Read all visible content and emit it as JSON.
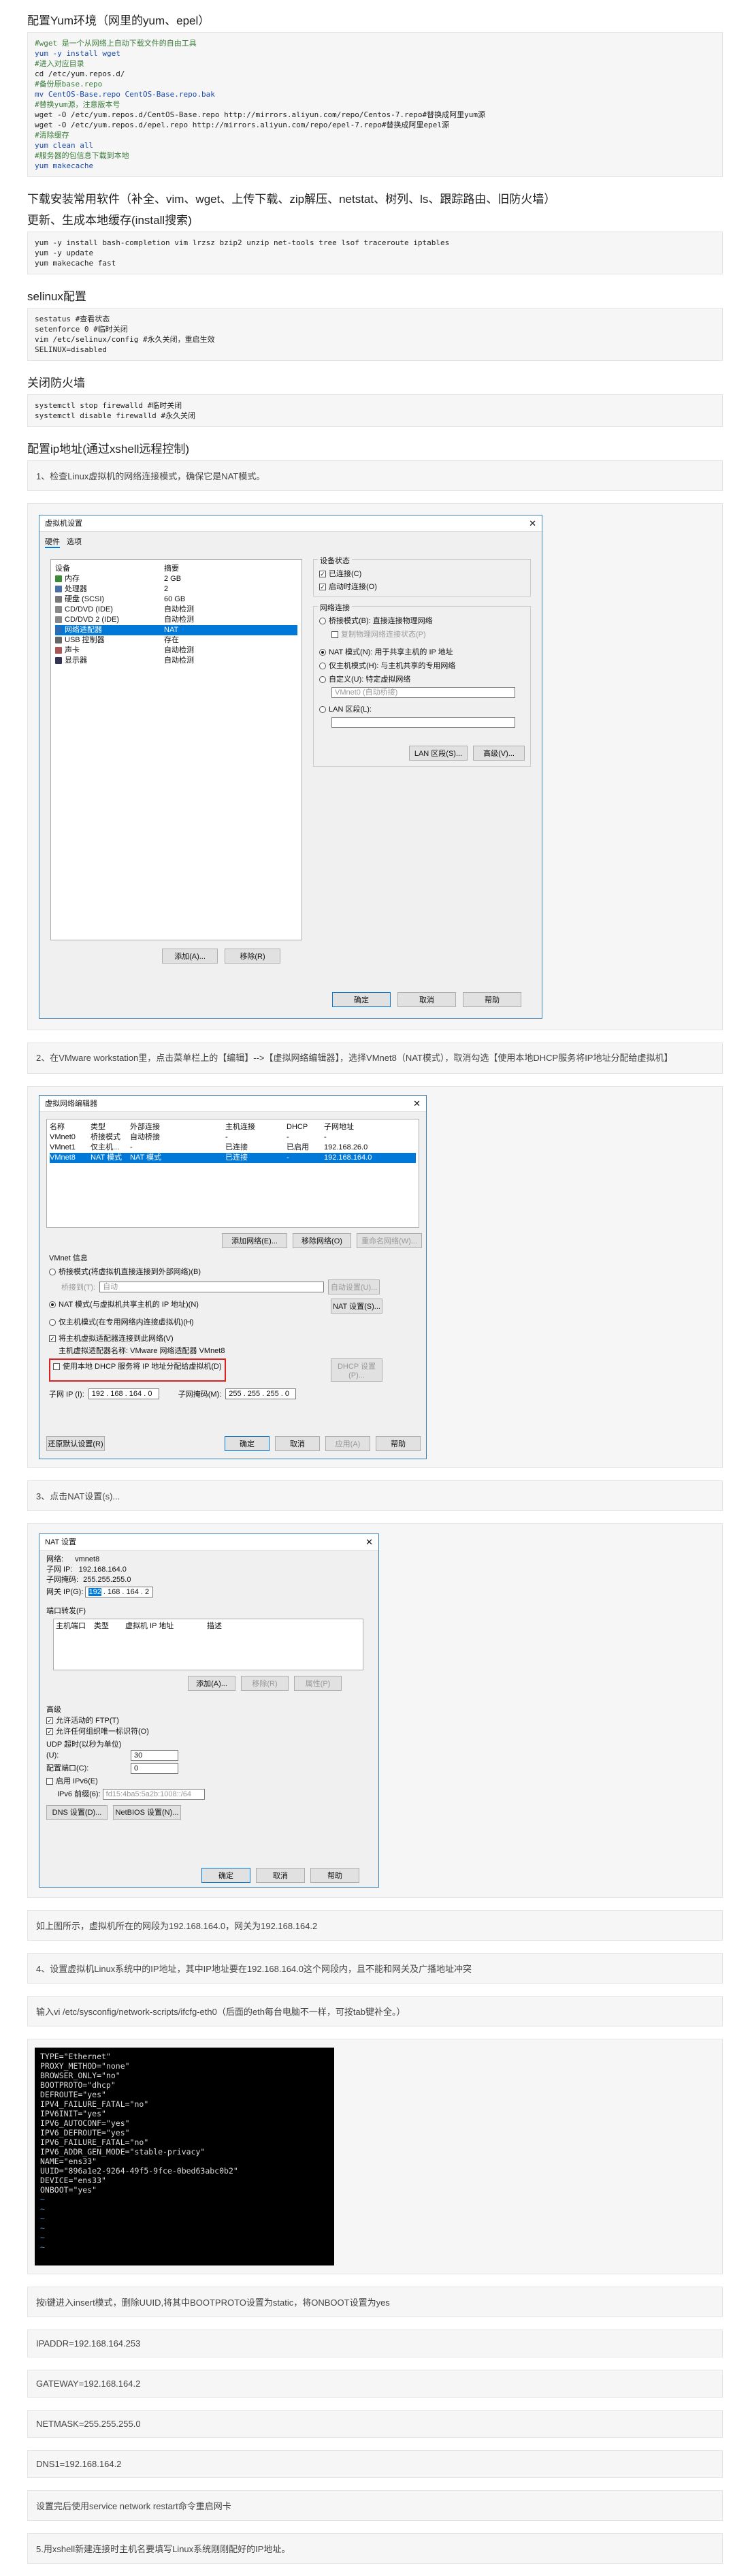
{
  "yum": {
    "title": "配置Yum环境（网里的yum、epel）",
    "lines": [
      {
        "t": "#wget 是一个从网络上自动下载文件的自由工具",
        "c": "c"
      },
      {
        "t": "yum -y install wget",
        "c": "k"
      },
      {
        "t": "#进入对应目录",
        "c": "c"
      },
      {
        "t": "cd /etc/yum.repos.d/",
        "c": ""
      },
      {
        "t": "#备份原base.repo",
        "c": "c"
      },
      {
        "t": "mv CentOS-Base.repo CentOS-Base.repo.bak",
        "c": "k"
      },
      {
        "t": "#替换yum源，注意版本号",
        "c": "c"
      },
      {
        "t": "wget -O /etc/yum.repos.d/CentOS-Base.repo http://mirrors.aliyun.com/repo/Centos-7.repo#替换成阿里yum源",
        "c": ""
      },
      {
        "t": "wget -O /etc/yum.repos.d/epel.repo http://mirrors.aliyun.com/repo/epel-7.repo#替换成阿里epel源",
        "c": ""
      },
      {
        "t": "#清除缓存",
        "c": "c"
      },
      {
        "t": "yum clean all",
        "c": "k"
      },
      {
        "t": "#服务器的包信息下载到本地",
        "c": "c"
      },
      {
        "t": "yum makecache",
        "c": "k"
      }
    ]
  },
  "soft": {
    "title": "下载安装常用软件（补全、vim、wget、上传下载、zip解压、netstat、树列、ls、跟踪路由、旧防火墙）",
    "title2": "更新、生成本地缓存(install搜索)",
    "lines": [
      "yum -y install bash-completion vim lrzsz bzip2 unzip net-tools tree lsof traceroute iptables",
      "yum -y update",
      "yum makecache fast"
    ]
  },
  "selinux": {
    "title": "selinux配置",
    "lines": [
      "sestatus #查看状态",
      "setenforce 0 #临时关闭",
      "vim /etc/selinux/config #永久关闭，重启生效",
      "SELINUX=disabled"
    ]
  },
  "firewall": {
    "title": "关闭防火墙",
    "lines": [
      "systemctl stop firewalld #临时关闭",
      "systemctl disable firewalld #永久关闭"
    ]
  },
  "ip": {
    "title": "配置ip地址(通过xshell远程控制)",
    "step1": "1、检查Linux虚拟机的网络连接模式，确保它是NAT模式。",
    "step2": "2、在VMware workstation里，点击菜单栏上的【编辑】-->【虚拟网络编辑器】，选择VMnet8（NAT模式），取消勾选【使用本地DHCP服务将IP地址分配给虚拟机】",
    "step3": "3、点击NAT设置(s)...",
    "note_gw": "如上图所示，虚拟机所在的网段为192.168.164.0，网关为192.168.164.2",
    "step4": "4、设置虚拟机Linux系统中的IP地址，其中IP地址要在192.168.164.0这个网段内，且不能和网关及广播地址冲突",
    "step5": "输入vi /etc/sysconfig/network-scripts/ifcfg-eth0（后面的eth每台电脑不一样，可按tab键补全。）",
    "edit_note": "按i键进入insert模式，删除UUID,将其中BOOTPROTO设置为static，将ONBOOT设置为yes",
    "ipaddr": "IPADDR=192.168.164.253",
    "gateway": "GATEWAY=192.168.164.2",
    "netmask": "NETMASK=255.255.255.0",
    "dns": "DNS1=192.168.164.2",
    "restart": "设置完后使用service network restart命令重启网卡",
    "xshell": "5.用xshell新建连接时主机名要填写Linux系统刚刚配好的IP地址。"
  },
  "vm_dialog": {
    "title": "虚拟机设置",
    "tabs": [
      "硬件",
      "选项"
    ],
    "col_device": "设备",
    "col_summary": "摘要",
    "devices": [
      {
        "name": "内存",
        "summary": "2 GB",
        "color": "#3a8a3a"
      },
      {
        "name": "处理器",
        "summary": "2",
        "color": "#4a6fa5"
      },
      {
        "name": "硬盘 (SCSI)",
        "summary": "60 GB",
        "color": "#777"
      },
      {
        "name": "CD/DVD (IDE)",
        "summary": "自动检测",
        "color": "#888"
      },
      {
        "name": "CD/DVD 2 (IDE)",
        "summary": "自动检测",
        "color": "#888"
      },
      {
        "name": "网络适配器",
        "summary": "NAT",
        "color": "#2f6bb3"
      },
      {
        "name": "USB 控制器",
        "summary": "存在",
        "color": "#666"
      },
      {
        "name": "声卡",
        "summary": "自动检测",
        "color": "#a55"
      },
      {
        "name": "显示器",
        "summary": "自动检测",
        "color": "#335"
      }
    ],
    "status_title": "设备状态",
    "connected": "已连接(C)",
    "connect_on_start": "启动时连接(O)",
    "net_title": "网络连接",
    "opt_bridged": "桥接模式(B): 直接连接物理网络",
    "opt_replicate": "复制物理网络连接状态(P)",
    "opt_nat": "NAT 模式(N): 用于共享主机的 IP 地址",
    "opt_host": "仅主机模式(H): 与主机共享的专用网络",
    "opt_custom": "自定义(U): 特定虚拟网络",
    "custom_val": "VMnet0 (自动桥接)",
    "opt_lan": "LAN 区段(L):",
    "lan_btn": "LAN 区段(S)...",
    "adv_btn": "高级(V)...",
    "add_btn": "添加(A)...",
    "remove_btn": "移除(R)",
    "ok": "确定",
    "cancel": "取消",
    "help": "帮助"
  },
  "vne_dialog": {
    "title": "虚拟网络编辑器",
    "cols": [
      "名称",
      "类型",
      "外部连接",
      "主机连接",
      "DHCP",
      "子网地址"
    ],
    "rows": [
      [
        "VMnet0",
        "桥接模式",
        "自动桥接",
        "-",
        "-",
        "-"
      ],
      [
        "VMnet1",
        "仅主机...",
        "-",
        "已连接",
        "已启用",
        "192.168.26.0"
      ],
      [
        "VMnet8",
        "NAT 模式",
        "NAT 模式",
        "已连接",
        "-",
        "192.168.164.0"
      ]
    ],
    "add_net": "添加网络(E)...",
    "remove_net": "移除网络(O)",
    "rename_net": "重命名网络(W)...",
    "info_title": "VMnet 信息",
    "opt_bridged": "桥接模式(将虚拟机直接连接到外部网络)(B)",
    "bridged_to": "桥接到(T):",
    "bridged_val": "自动",
    "auto_settings": "自动设置(U)...",
    "opt_nat": "NAT 模式(与虚拟机共享主机的 IP 地址)(N)",
    "nat_settings": "NAT 设置(S)...",
    "opt_host": "仅主机模式(在专用网络内连接虚拟机)(H)",
    "chk_adapter": "将主机虚拟适配器连接到此网络(V)",
    "adapter_name": "主机虚拟适配器名称: VMware 网络适配器 VMnet8",
    "chk_dhcp": "使用本地 DHCP 服务将 IP 地址分配给虚拟机(D)",
    "dhcp_settings": "DHCP 设置(P)...",
    "subnet_ip_label": "子网 IP (I):",
    "subnet_ip": "192 . 168 . 164 . 0",
    "mask_label": "子网掩码(M):",
    "mask": "255 . 255 . 255 . 0",
    "restore": "还原默认设置(R)",
    "ok": "确定",
    "cancel": "取消",
    "apply": "应用(A)",
    "help": "帮助"
  },
  "nat_dialog": {
    "title": "NAT 设置",
    "network_label": "网络:",
    "network": "vmnet8",
    "subnet_ip_label": "子网 IP:",
    "subnet_ip": "192.168.164.0",
    "mask_label": "子网掩码:",
    "mask": "255.255.255.0",
    "gw_label": "网关 IP(G):",
    "gw_sel": "192",
    "gw_rest": ". 168 . 164 . 2",
    "port_title": "端口转发(F)",
    "port_cols": [
      "主机端口",
      "类型",
      "虚拟机 IP 地址",
      "描述"
    ],
    "add": "添加(A)...",
    "remove": "移除(R)",
    "props": "属性(P)",
    "adv_title": "高级",
    "chk_ftp": "允许活动的 FTP(T)",
    "chk_oui": "允许任何组织唯一标识符(O)",
    "udp_label": "UDP 超时(以秒为单位)(U):",
    "udp": "30",
    "cfg_port_label": "配置端口(C):",
    "cfg_port": "0",
    "chk_ipv6": "启用 IPv6(E)",
    "ipv6_label": "IPv6 前缀(6):",
    "ipv6": "fd15:4ba5:5a2b:1008::/64",
    "dns_btn": "DNS 设置(D)...",
    "netbios_btn": "NetBIOS 设置(N)...",
    "ok": "确定",
    "cancel": "取消",
    "help": "帮助"
  },
  "terminal": {
    "lines": [
      "TYPE=\"Ethernet\"",
      "PROXY_METHOD=\"none\"",
      "BROWSER_ONLY=\"no\"",
      "BOOTPROTO=\"dhcp\"",
      "DEFROUTE=\"yes\"",
      "IPV4_FAILURE_FATAL=\"no\"",
      "IPV6INIT=\"yes\"",
      "IPV6_AUTOCONF=\"yes\"",
      "IPV6_DEFROUTE=\"yes\"",
      "IPV6_FAILURE_FATAL=\"no\"",
      "IPV6_ADDR_GEN_MODE=\"stable-privacy\"",
      "NAME=\"ens33\"",
      "UUID=\"896a1e2-9264-49f5-9fce-0bed63abc0b2\"",
      "DEVICE=\"ens33\"",
      "ONBOOT=\"yes\""
    ],
    "tilde": "~"
  },
  "colors": {
    "accent": "#0078d7",
    "highlight_box": "#e02020"
  }
}
